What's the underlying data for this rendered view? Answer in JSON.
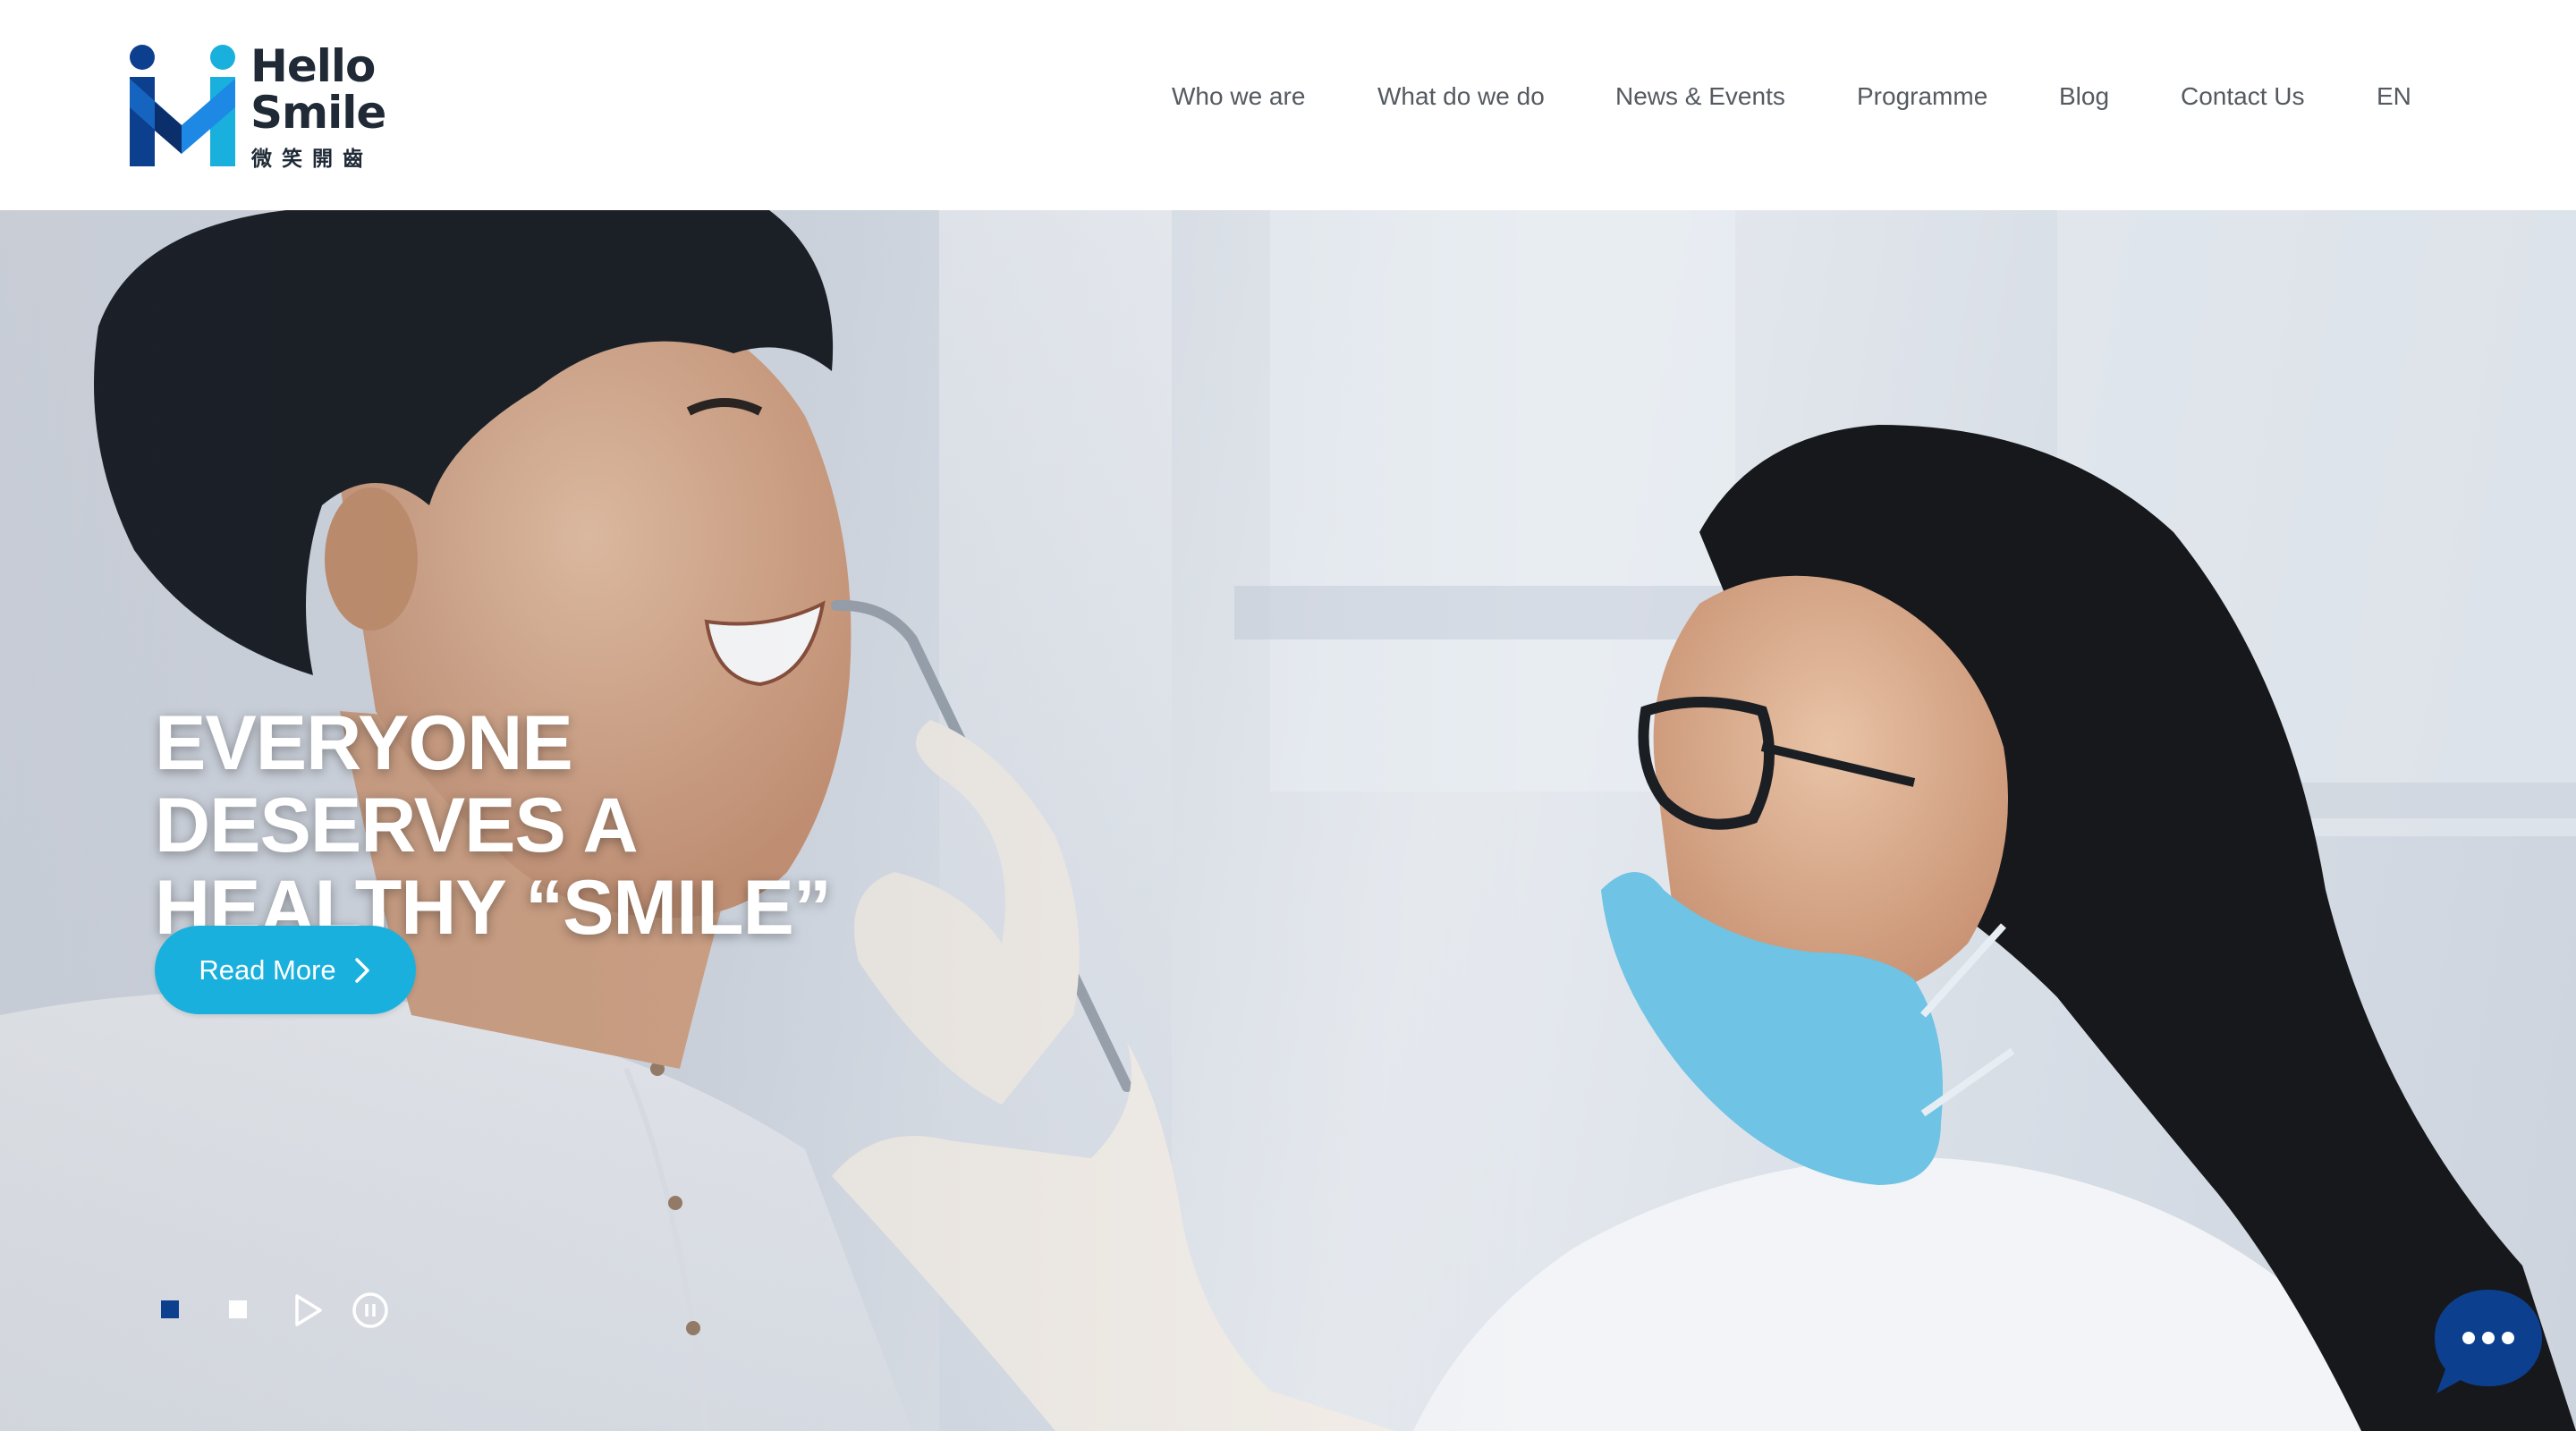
{
  "brand": {
    "name_line1": "Hello",
    "name_line2": "Smile",
    "name_cjk": "微笑開齒",
    "colors": {
      "logo_dark": "#0d3f8f",
      "logo_mid": "#1565c0",
      "logo_light": "#1ab0dd",
      "text": "#1f2a36"
    }
  },
  "nav": {
    "items": [
      {
        "label": "Who we are"
      },
      {
        "label": "What do we do"
      },
      {
        "label": "News & Events"
      },
      {
        "label": "Programme"
      },
      {
        "label": "Blog"
      },
      {
        "label": "Contact Us"
      },
      {
        "label": "EN"
      }
    ]
  },
  "hero": {
    "headline_lines": [
      "EVERYONE",
      "DESERVES A",
      "HEALTHY “SMILE”"
    ],
    "cta_label": "Read More",
    "cta_icon": "chevron-right-icon",
    "cta_color": "#1ab0dd",
    "image_subject": "dentist-examining-patient-photo",
    "slides": {
      "total": 2,
      "current": 1
    },
    "controls": [
      "play-icon",
      "pause-icon"
    ],
    "active_dot_color": "#0d3f8f"
  },
  "chat": {
    "icon": "chat-bubble-icon",
    "color": "#0d3f8f"
  }
}
